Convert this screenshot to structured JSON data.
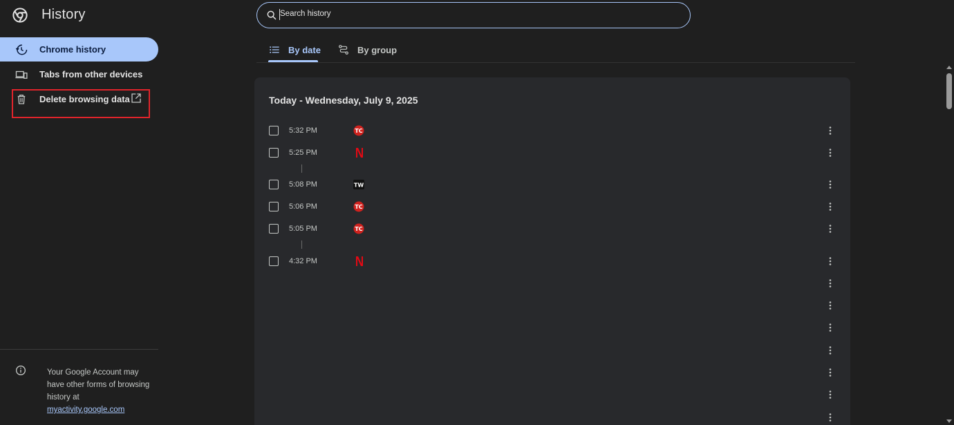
{
  "app": {
    "title": "History",
    "icon": "chrome-logo-icon"
  },
  "sidebar": {
    "items": [
      {
        "label": "Chrome history",
        "icon": "history-icon",
        "active": true
      },
      {
        "label": "Tabs from other devices",
        "icon": "devices-icon",
        "active": false
      },
      {
        "label": "Delete browsing data",
        "icon": "trash-icon",
        "active": false,
        "external": "external-link-icon"
      }
    ],
    "footer": {
      "icon": "info-icon",
      "text": "Your Google Account may have other forms of browsing history at",
      "link": "myactivity.google.com"
    }
  },
  "search": {
    "placeholder": "Search history",
    "icon": "search-icon"
  },
  "tabs": [
    {
      "label": "By date",
      "icon": "list-icon",
      "active": true
    },
    {
      "label": "By group",
      "icon": "group-icon",
      "active": false
    }
  ],
  "history": {
    "heading": "Today - Wednesday, July 9, 2025",
    "entries": [
      {
        "time": "5:32 PM",
        "favicon": "tc-favicon"
      },
      {
        "time": "5:25 PM",
        "favicon": "netflix-favicon"
      },
      {
        "time": "5:08 PM",
        "favicon": "tw-favicon"
      },
      {
        "time": "5:06 PM",
        "favicon": "tc-favicon"
      },
      {
        "time": "5:05 PM",
        "favicon": "tc-favicon"
      },
      {
        "time": "4:32 PM",
        "favicon": "netflix-favicon"
      }
    ]
  },
  "colors": {
    "accent": "#a8c7fa",
    "background": "#1f1f1f",
    "card": "#28292c",
    "highlight": "#e0242b",
    "netflix": "#e50914",
    "tc": "#d0221e"
  }
}
